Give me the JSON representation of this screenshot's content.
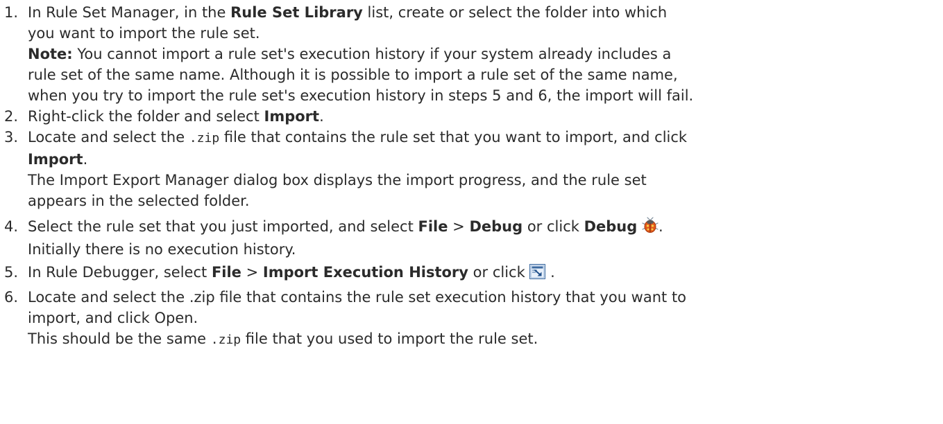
{
  "steps": [
    {
      "number": "1.",
      "text_a": "In Rule Set Manager, in the ",
      "bold_a": "Rule Set Library",
      "text_b": " list, create or select the folder into which",
      "line2": "you want to import the rule set.",
      "note_label": "Note:",
      "note_text": " You cannot import a rule set's execution history if your system already includes a",
      "note_line2": "rule set of the same name. Although it is possible to import a rule set of the same name,",
      "note_line3": "when you try to import the rule set's execution history in steps 5 and 6, the import will fail."
    },
    {
      "number": "2.",
      "text_a": "Right-click the folder and select ",
      "bold_a": "Import",
      "text_b": "."
    },
    {
      "number": "3.",
      "text_a": "Locate and select the ",
      "code_a": ".zip",
      "text_b": " file that contains the rule set that you want to import, and click",
      "bold_a": "Import",
      "text_c": ".",
      "result_line1": "The Import Export Manager dialog box displays the import progress, and the rule set",
      "result_line2": "appears in the selected folder."
    },
    {
      "number": "4.",
      "text_a": "Select the rule set that you just imported, and select ",
      "bold_a": "File",
      "sep": " > ",
      "bold_b": "Debug",
      "text_b": " or click ",
      "bold_c": "Debug",
      "text_c": ".",
      "icon": "ladybug-debug-icon",
      "result_line1": "Initially there is no execution history."
    },
    {
      "number": "5.",
      "text_a": "In Rule Debugger, select ",
      "bold_a": "File",
      "sep": " > ",
      "bold_b": "Import Execution History",
      "text_b": " or click ",
      "text_c": " .",
      "icon": "import-execution-history-icon"
    },
    {
      "number": "6.",
      "text_a": "Locate and select the .zip file that contains the rule set execution history that you want to",
      "line2": "import, and click Open.",
      "result_a": "This should be the same ",
      "code_a": ".zip",
      "result_b": " file that you used to import the rule set."
    }
  ]
}
